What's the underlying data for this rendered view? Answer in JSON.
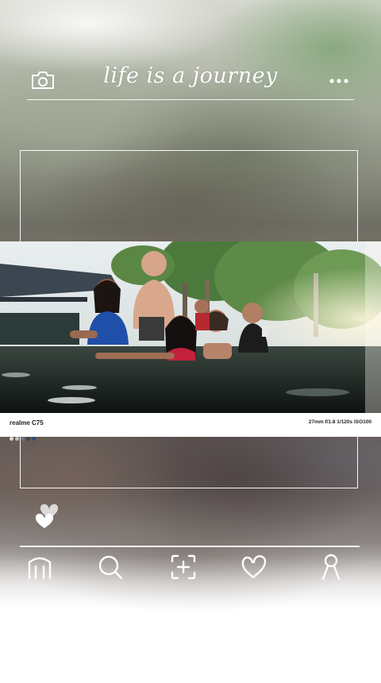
{
  "header": {
    "title": "life is a journey",
    "camera_icon": "camera-icon",
    "more_icon": "more-dots-icon"
  },
  "photo": {
    "device_label": "realme C75",
    "camera_info": "27mm f/1.8 1/120s ISO100",
    "palette": [
      "#d8d8d8",
      "#c9c2bd",
      "#6c7488",
      "#3f4456",
      "#2f4f78"
    ]
  },
  "like_icon": "double-heart-icon",
  "nav": {
    "items": [
      {
        "icon": "home-icon"
      },
      {
        "icon": "search-icon"
      },
      {
        "icon": "add-post-icon"
      },
      {
        "icon": "heart-icon"
      },
      {
        "icon": "profile-icon"
      }
    ]
  },
  "colors": {
    "line": "#ffffff",
    "accent": "#ffffff"
  }
}
